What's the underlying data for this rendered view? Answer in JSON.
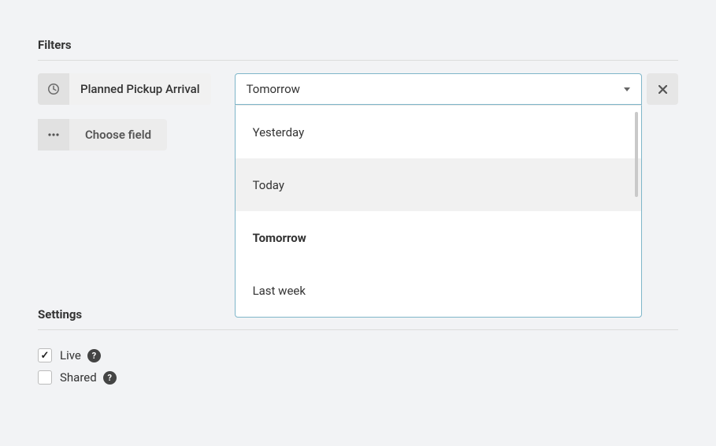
{
  "filters": {
    "title": "Filters",
    "rows": [
      {
        "field_label": "Planned Pickup Arrival",
        "selected_value": "Tomorrow"
      }
    ],
    "choose_field_label": "Choose field",
    "dropdown_options": [
      {
        "label": "Yesterday",
        "selected": false,
        "hovered": false
      },
      {
        "label": "Today",
        "selected": false,
        "hovered": true
      },
      {
        "label": "Tomorrow",
        "selected": true,
        "hovered": false
      },
      {
        "label": "Last week",
        "selected": false,
        "hovered": false
      }
    ]
  },
  "settings": {
    "title": "Settings",
    "items": [
      {
        "label": "Live",
        "checked": true
      },
      {
        "label": "Shared",
        "checked": false
      }
    ]
  }
}
